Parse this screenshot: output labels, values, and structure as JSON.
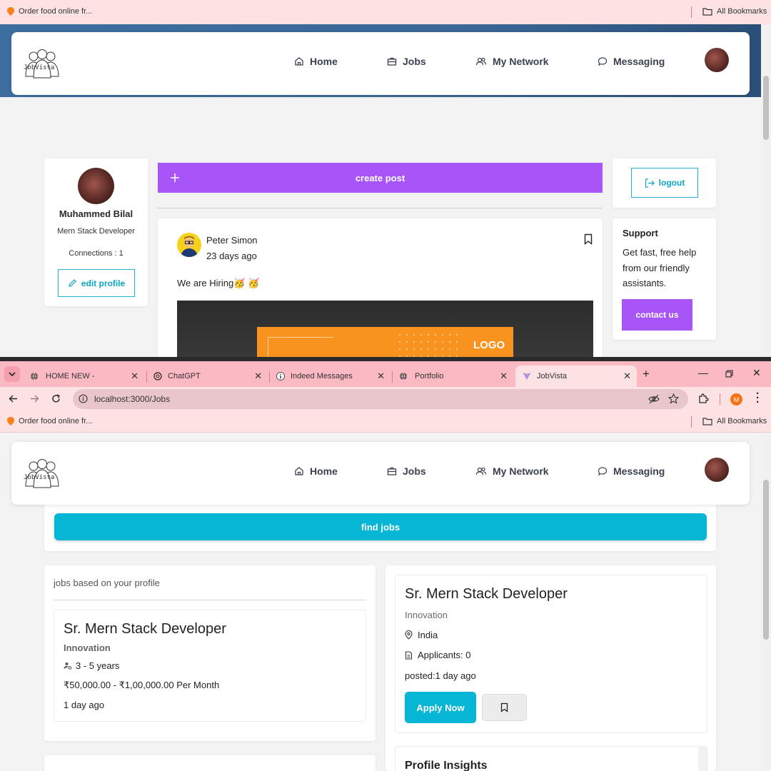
{
  "top": {
    "bookmark": {
      "label": "Order food online fr...",
      "all_bookmarks": "All Bookmarks"
    },
    "nav": {
      "home": "Home",
      "jobs": "Jobs",
      "network": "My Network",
      "messaging": "Messaging",
      "logo_text": "JobVista"
    },
    "profile": {
      "name": "Muhammed Bilal",
      "title": "Mern Stack Developer",
      "connections": "Connections : 1",
      "edit_label": "edit profile"
    },
    "create_post_label": "create post",
    "post": {
      "author": "Peter Simon",
      "time": "23 days ago",
      "text": "We are Hiring🥳 🥳",
      "image_logo_text": "LOGO"
    },
    "logout_label": "logout",
    "support": {
      "title": "Support",
      "text": "Get fast, free help from our friendly assistants.",
      "button": "contact us"
    }
  },
  "browser": {
    "tabs": [
      {
        "label": "HOME NEW -"
      },
      {
        "label": "ChatGPT"
      },
      {
        "label": "Indeed Messages"
      },
      {
        "label": "Portfolio"
      },
      {
        "label": "JobVista"
      }
    ],
    "url": "localhost:3000/Jobs",
    "bookmark": "Order food online fr...",
    "all_bookmarks": "All Bookmarks",
    "profile_initial": "M"
  },
  "bottom": {
    "nav": {
      "home": "Home",
      "jobs": "Jobs",
      "network": "My Network",
      "messaging": "Messaging",
      "logo_text": "JobVista"
    },
    "find_jobs_label": "find jobs",
    "jobs_heading": "jobs based on your profile",
    "job_card": {
      "title": "Sr. Mern Stack Developer",
      "company": "Innovation",
      "experience": "3 - 5 years",
      "salary": "₹50,000.00 - ₹1,00,000.00 Per Month",
      "posted": "1 day ago"
    },
    "job_detail": {
      "title": "Sr. Mern Stack Developer",
      "company": "Innovation",
      "location": "India",
      "applicants": "Applicants: 0",
      "posted": "posted:1 day ago",
      "apply_label": "Apply Now"
    },
    "profile_insights": "Profile Insights"
  },
  "colors": {
    "accent_purple": "#a855f7",
    "accent_cyan": "#06b6d4",
    "tab_strip": "#fbb9c3",
    "bookmark_bar": "#fde2e4"
  }
}
